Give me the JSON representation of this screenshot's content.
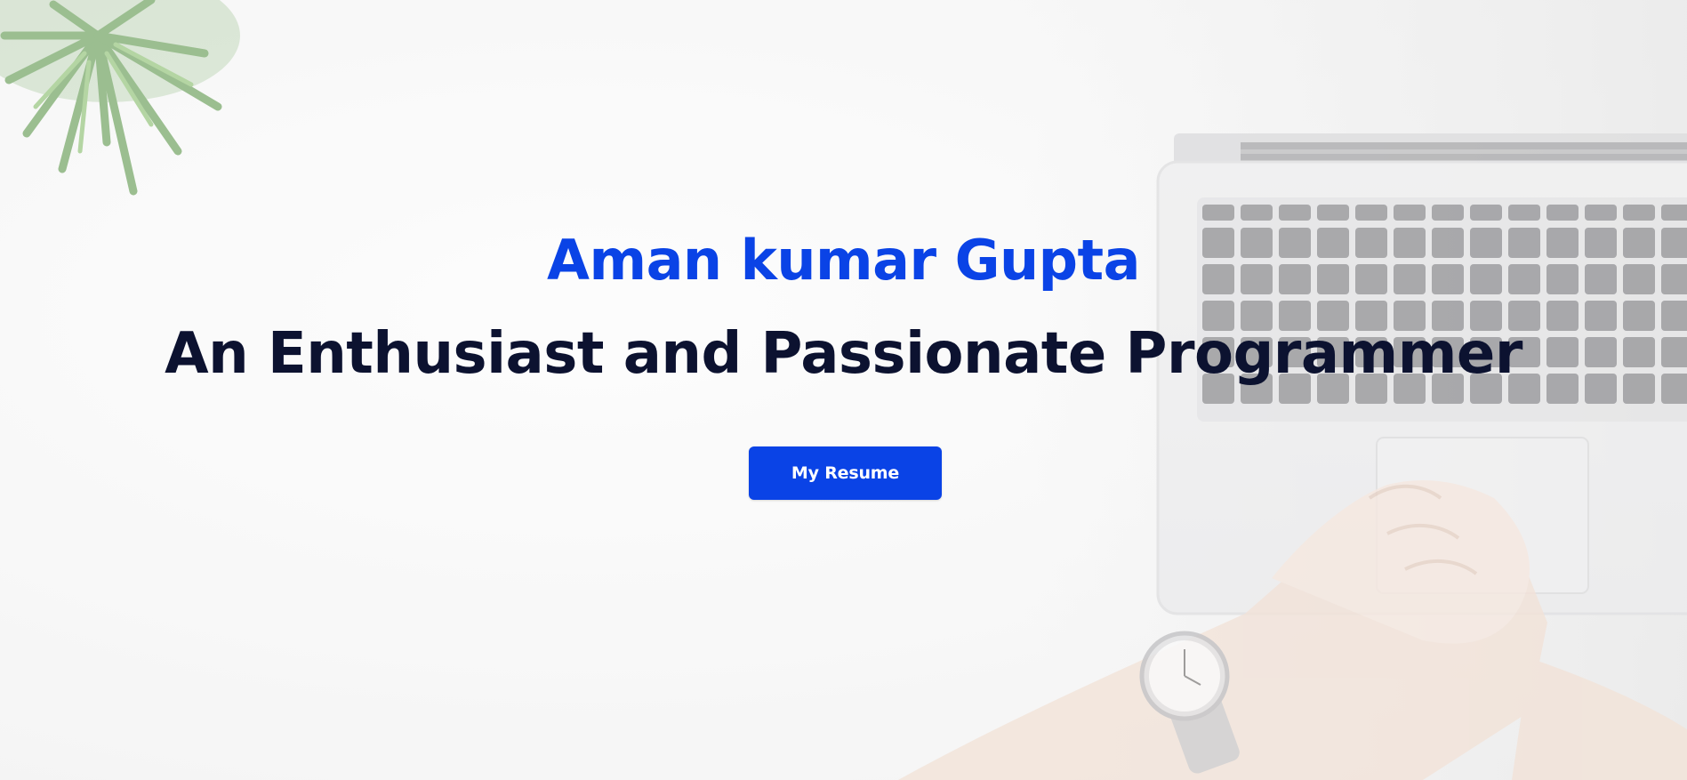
{
  "hero": {
    "name": "Aman kumar Gupta",
    "tagline": "An Enthusiast and Passionate Programmer",
    "resume_button_label": "My Resume"
  },
  "background": {
    "description_icons": [
      "plant-image",
      "laptop-image",
      "hands-image",
      "wristwatch-image"
    ]
  },
  "colors": {
    "accent": "#0a43e6",
    "heading_dark": "#0c1230",
    "background": "#f4f4f4"
  }
}
